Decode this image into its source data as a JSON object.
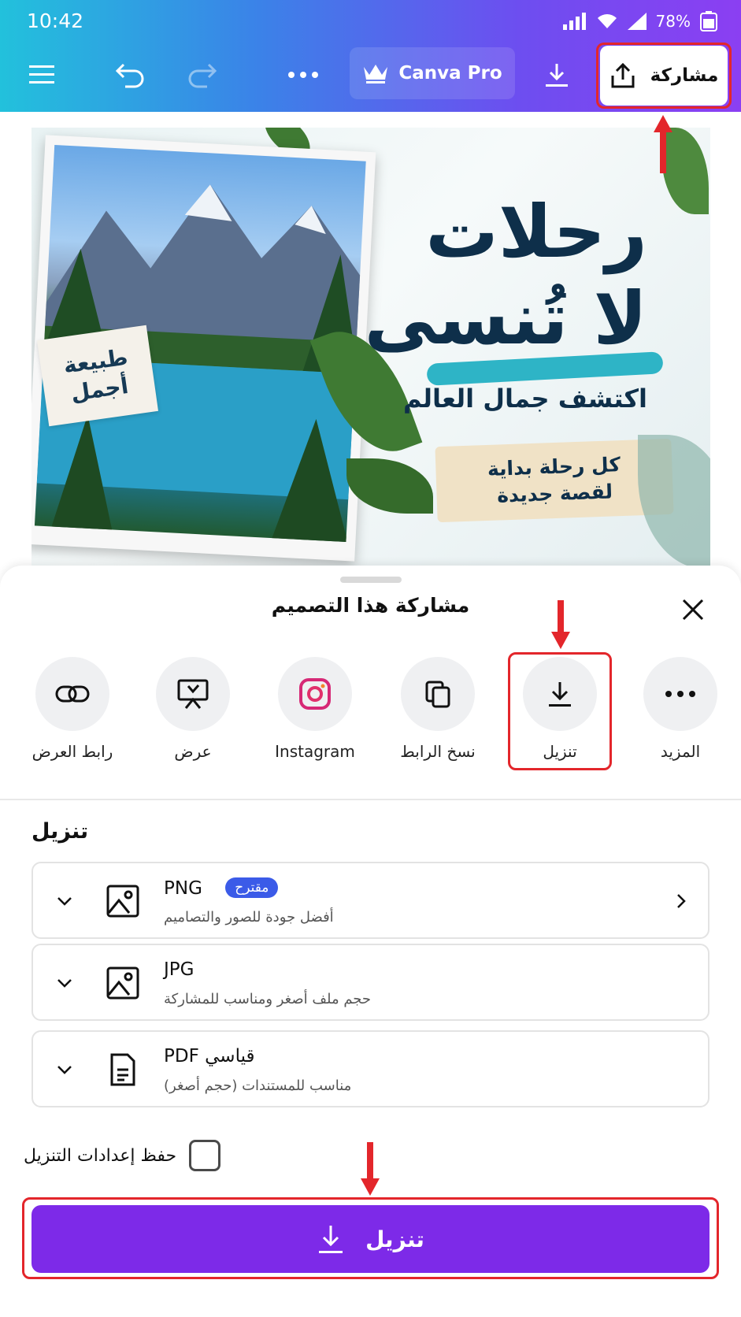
{
  "status_bar": {
    "time": "10:42",
    "battery": "78%"
  },
  "toolbar": {
    "pro_label": "Canva Pro",
    "share_label": "مشاركة"
  },
  "design": {
    "title_line1": "رحلات",
    "title_line2": "لا تُنسى",
    "subtitle": "اكتشف جمال العالم",
    "tag_line1": "كل رحلة بداية",
    "tag_line2": "لقصة جديدة",
    "badge_line1": "طبيعة",
    "badge_line2": "أجمل"
  },
  "sheet": {
    "title": "مشاركة هذا التصميم",
    "options": [
      {
        "label": "المزيد",
        "icon": "more-icon"
      },
      {
        "label": "تنزيل",
        "icon": "download-icon"
      },
      {
        "label": "نسخ الرابط",
        "icon": "copy-icon"
      },
      {
        "label": "Instagram",
        "icon": "instagram-icon"
      },
      {
        "label": "عرض",
        "icon": "present-icon"
      },
      {
        "label": "رابط العرض",
        "icon": "link-icon"
      }
    ],
    "download_heading": "تنزيل",
    "formats": [
      {
        "name": "PNG",
        "badge": "مقترح",
        "desc": "أفضل جودة للصور والتصاميم"
      },
      {
        "name": "JPG",
        "desc": "حجم ملف أصغر ومناسب للمشاركة"
      },
      {
        "name": "PDF قياسي",
        "desc": "مناسب للمستندات (حجم أصغر)"
      }
    ],
    "save_settings_label": "حفظ إعدادات التنزيل",
    "download_button": "تنزيل"
  },
  "colors": {
    "accent": "#7d2ae8",
    "highlight": "#e3262b",
    "suggest_badge": "#3b5be8"
  }
}
